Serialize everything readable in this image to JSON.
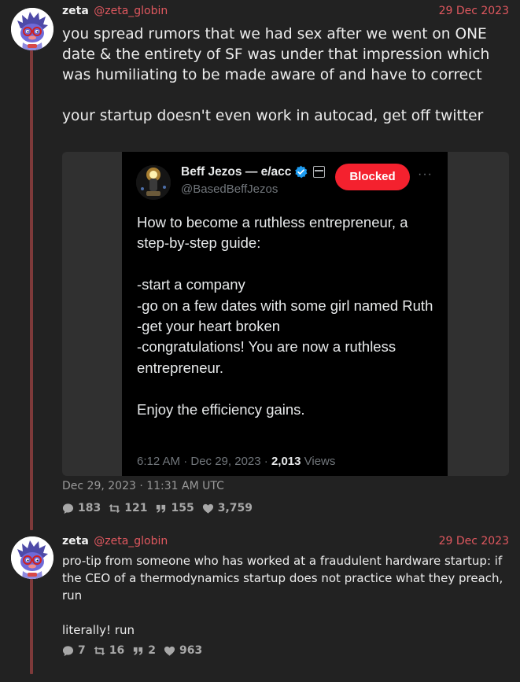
{
  "tweets": [
    {
      "name": "zeta",
      "handle": "@zeta_globin",
      "date": "29 Dec 2023",
      "text": "you spread rumors that we had sex after we went on ONE date & the entirety of SF was under that impression which was humiliating to be made aware of and have to correct\n\nyour startup doesn't even work in autocad, get off twitter",
      "timestamp": "Dec 29, 2023 · 11:31 AM UTC",
      "stats": {
        "replies": "183",
        "retweets": "121",
        "quotes": "155",
        "likes": "3,759"
      }
    },
    {
      "name": "zeta",
      "handle": "@zeta_globin",
      "date": "29 Dec 2023",
      "text": "pro-tip from someone who has worked at a fraudulent hardware startup: if the CEO of a thermodynamics startup does not practice what they preach, run\n\nliterally! run",
      "stats": {
        "replies": "7",
        "retweets": "16",
        "quotes": "2",
        "likes": "963"
      }
    }
  ],
  "embed": {
    "name": "Beff Jezos — e/acc",
    "handle": "@BasedBeffJezos",
    "blocked_label": "Blocked",
    "more": "···",
    "text": "How to become a ruthless entrepreneur, a step-by-step guide:\n\n-start a company\n-go on a few dates with some girl named Ruth\n-get your heart broken\n-congratulations! You are now a ruthless entrepreneur.\n\nEnjoy the efficiency gains.",
    "time": "6:12 AM · Dec 29, 2023 · ",
    "views_count": "2,013",
    "views_label": " Views"
  },
  "colors": {
    "background": "#222222",
    "accent": "#e0585f",
    "thread_line": "#7e3a3a",
    "blocked": "#f4212e",
    "verified": "#1d9bf0"
  },
  "icons": [
    "avatar-creature",
    "verified-badge-icon",
    "reply-icon",
    "retweet-icon",
    "quote-icon",
    "heart-icon"
  ]
}
